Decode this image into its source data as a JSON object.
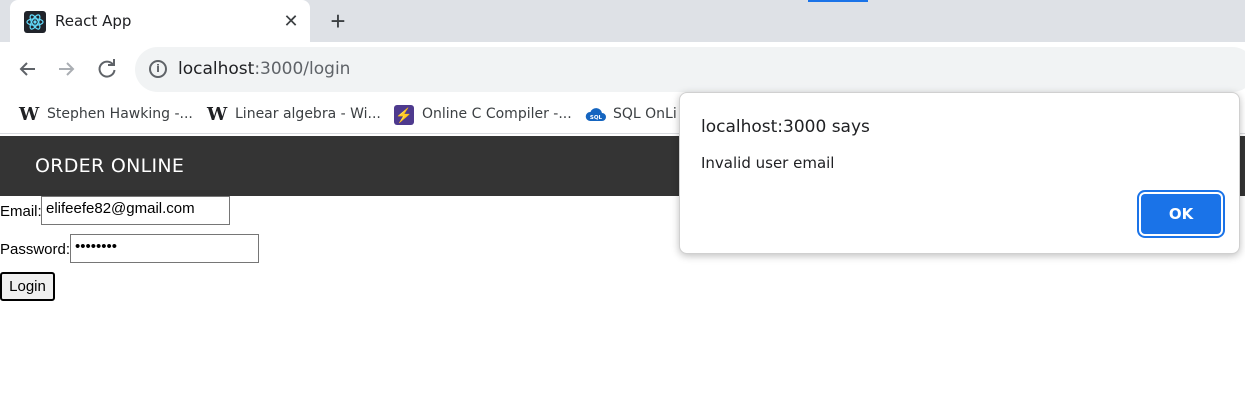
{
  "browser": {
    "tab_title": "React App",
    "tab_favicon": "react-logo-icon",
    "close_icon": "close-icon",
    "new_tab_icon": "plus-icon",
    "nav": {
      "back_icon": "arrow-left-icon",
      "forward_icon": "arrow-right-icon",
      "reload_icon": "reload-icon"
    },
    "url_host": "localhost",
    "url_path": ":3000/login",
    "bookmarks": [
      {
        "label": "Stephen Hawking -...",
        "icon": "wikipedia-icon"
      },
      {
        "label": "Linear algebra - Wi...",
        "icon": "wikipedia-icon"
      },
      {
        "label": "Online C Compiler -...",
        "icon": "bolt-icon"
      },
      {
        "label": "SQL OnLi",
        "icon": "sql-cloud-icon"
      }
    ]
  },
  "page": {
    "brand": "ORDER ONLINE",
    "email_label": "Email:",
    "email_value": "elifeefe82@gmail.com",
    "password_label": "Password:",
    "password_value": "••••••••",
    "login_label": "Login"
  },
  "dialog": {
    "title": "localhost:3000 says",
    "message": "Invalid user email",
    "ok_label": "OK"
  },
  "colors": {
    "navbar_bg": "#343434",
    "dialog_button": "#1a73e8",
    "tabstrip_bg": "#dee1e6",
    "omnibox_bg": "#f1f3f4"
  }
}
